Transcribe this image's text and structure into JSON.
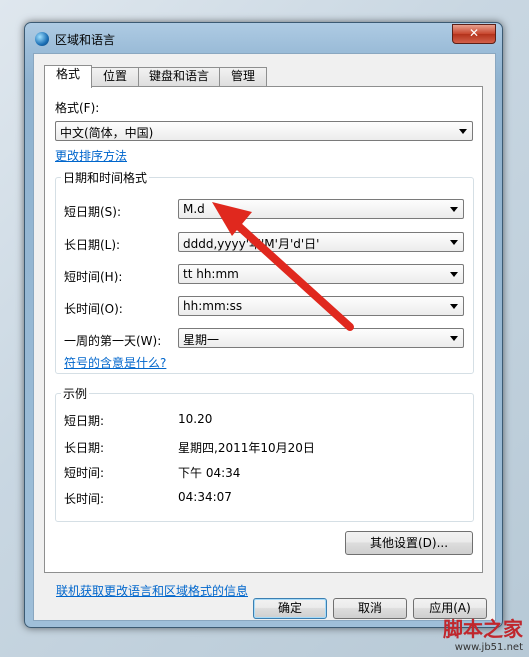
{
  "window": {
    "title": "区域和语言",
    "close_symbol": "✕"
  },
  "tabs": [
    {
      "label": "格式",
      "active": true
    },
    {
      "label": "位置",
      "active": false
    },
    {
      "label": "键盘和语言",
      "active": false
    },
    {
      "label": "管理",
      "active": false
    }
  ],
  "format": {
    "label": "格式(F):",
    "value": "中文(简体，中国)",
    "sort_link": "更改排序方法"
  },
  "datetime": {
    "group_title": "日期和时间格式",
    "short_date": {
      "label": "短日期(S):",
      "value": "M.d"
    },
    "long_date": {
      "label": "长日期(L):",
      "value": "dddd,yyyy'年'M'月'd'日'"
    },
    "short_time": {
      "label": "短时间(H):",
      "value": "tt hh:mm"
    },
    "long_time": {
      "label": "长时间(O):",
      "value": "hh:mm:ss"
    },
    "first_day": {
      "label": "一周的第一天(W):",
      "value": "星期一"
    },
    "symbols_link": "符号的含意是什么?"
  },
  "examples": {
    "group_title": "示例",
    "short_date": {
      "label": "短日期:",
      "value": "10.20"
    },
    "long_date": {
      "label": "长日期:",
      "value": "星期四,2011年10月20日"
    },
    "short_time": {
      "label": "短时间:",
      "value": "下午 04:34"
    },
    "long_time": {
      "label": "长时间:",
      "value": "04:34:07"
    }
  },
  "other_settings_button": "其他设置(D)...",
  "online_link": "联机获取更改语言和区域格式的信息",
  "buttons": {
    "ok": "确定",
    "cancel": "取消",
    "apply": "应用(A)"
  },
  "watermark": {
    "text": "脚本之家",
    "url": "www.jb51.net"
  },
  "colors": {
    "annotation_arrow": "#e0281e",
    "link": "#0066cc",
    "window_frame": "#9bbcd8"
  }
}
